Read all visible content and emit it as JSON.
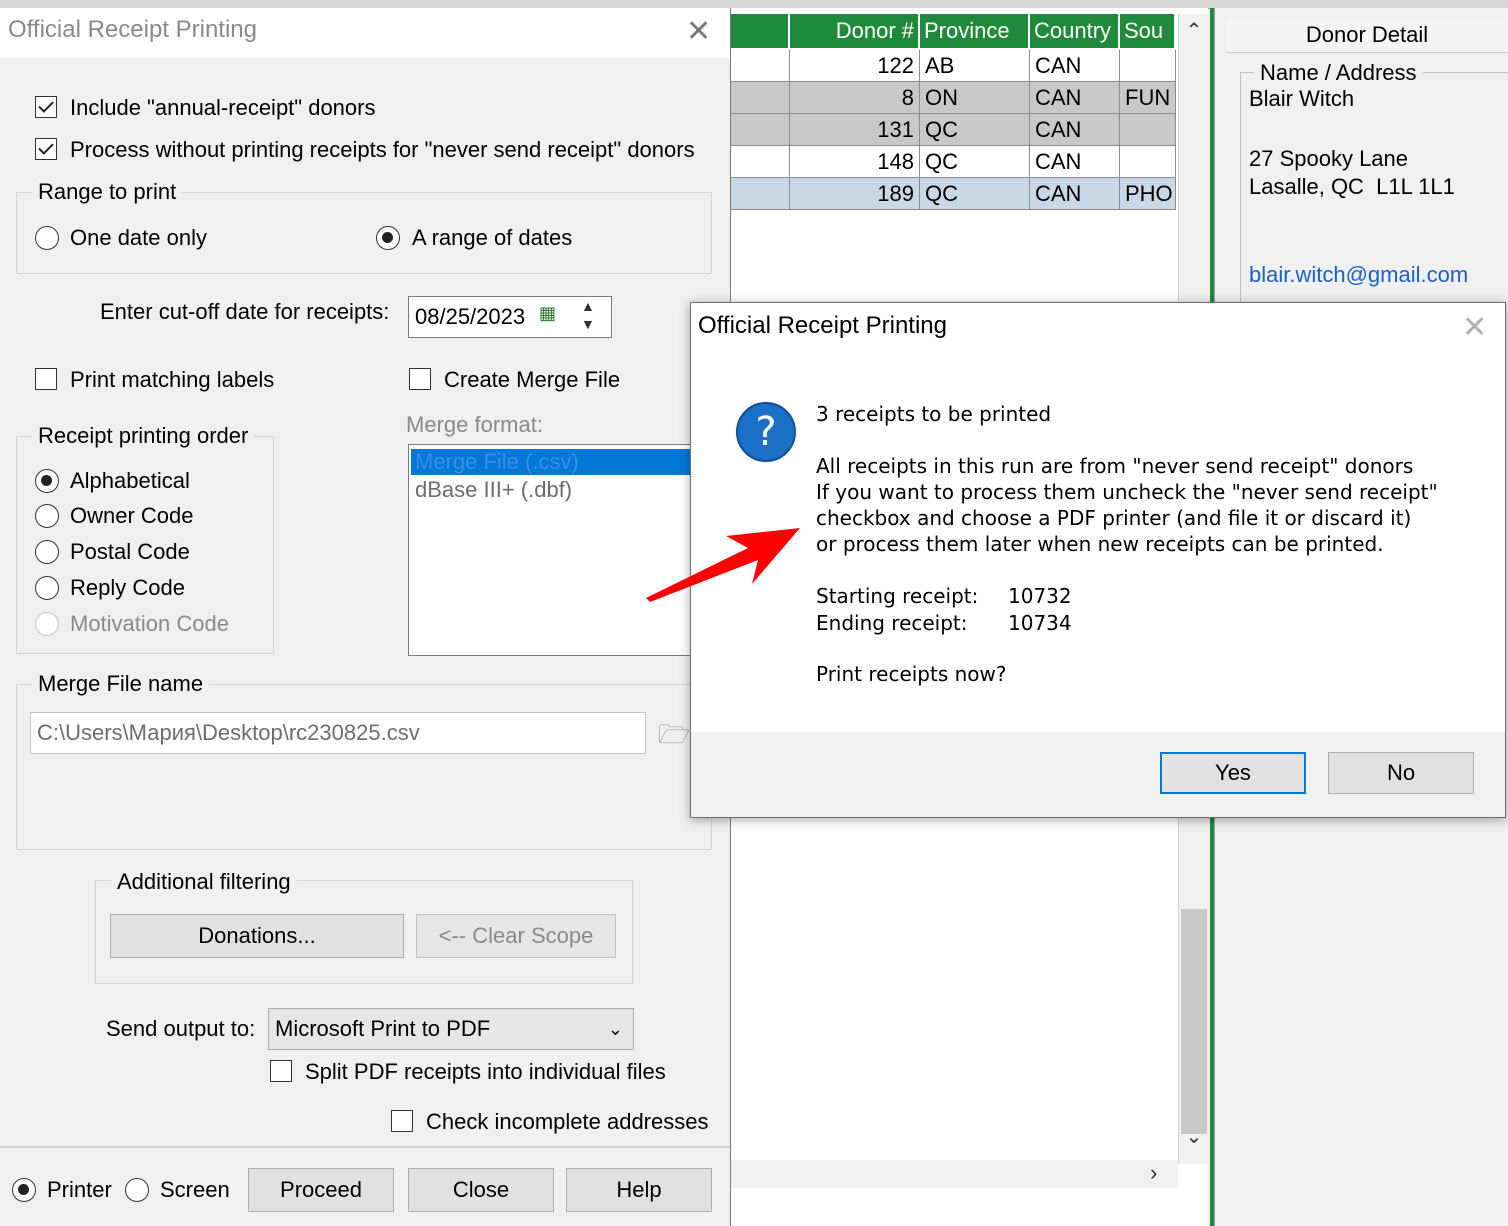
{
  "colors": {
    "grid_header": "#1f8a3c",
    "selection": "#0078d7",
    "link": "#1a5fd0",
    "arrow": "#ff0000"
  },
  "grid": {
    "columns": [
      "Donor #",
      "Province",
      "Country",
      "Sou"
    ],
    "rows": [
      {
        "donor": "122",
        "province": "AB",
        "country": "CAN",
        "source": ""
      },
      {
        "donor": "8",
        "province": "ON",
        "country": "CAN",
        "source": "FUN"
      },
      {
        "donor": "131",
        "province": "QC",
        "country": "CAN",
        "source": ""
      },
      {
        "donor": "148",
        "province": "QC",
        "country": "CAN",
        "source": ""
      },
      {
        "donor": "189",
        "province": "QC",
        "country": "CAN",
        "source": "PHO"
      }
    ]
  },
  "detail": {
    "title": "Donor Detail",
    "group_label": "Name / Address",
    "name": "Blair Witch",
    "address1": "27 Spooky Lane",
    "address2": "Lasalle, QC  L1L 1L1",
    "email": "blair.witch@gmail.com"
  },
  "main": {
    "title": "Official Receipt Printing",
    "include_annual": "Include \"annual-receipt\" donors",
    "process_without": "Process without printing receipts for \"never send receipt\" donors",
    "range_label": "Range to print",
    "one_date": "One date only",
    "range_dates": "A range of dates",
    "cutoff_label": "Enter cut-off date for receipts:",
    "cutoff_value": "08/25/2023",
    "print_labels": "Print matching labels",
    "create_merge": "Create Merge File",
    "merge_format_label": "Merge format:",
    "merge_formats": [
      "Merge File (.csv)",
      "dBase III+ (.dbf)"
    ],
    "order_label": "Receipt printing order",
    "order_options": [
      "Alphabetical",
      "Owner Code",
      "Postal Code",
      "Reply Code",
      "Motivation Code"
    ],
    "merge_name_label": "Merge File name",
    "merge_name_value": "C:\\Users\\Мария\\Desktop\\rc230825.csv",
    "filter_label": "Additional filtering",
    "donations_btn": "Donations...",
    "clear_scope_btn": "<-- Clear Scope",
    "send_output_label": "Send output to:",
    "send_output_value": "Microsoft Print to PDF",
    "split_pdf": "Split PDF receipts into individual files",
    "check_incomplete": "Check incomplete addresses",
    "printer": "Printer",
    "screen": "Screen",
    "proceed_btn": "Proceed",
    "close_btn": "Close",
    "help_btn": "Help"
  },
  "msgbox": {
    "title": "Official Receipt Printing",
    "icon": "question-icon",
    "headline": "3 receipts to be printed",
    "line1": "All receipts in this run are from \"never send receipt\" donors",
    "line2": "If you want to process them uncheck the \"never send receipt\"",
    "line3": "checkbox and choose a PDF printer (and file it or discard it)",
    "line4": "or process them later when new receipts can be printed.",
    "start_label": "Starting receipt:",
    "start_value": "10732",
    "end_label": "Ending receipt:",
    "end_value": "10734",
    "question": "Print receipts now?",
    "yes_btn": "Yes",
    "no_btn": "No"
  }
}
